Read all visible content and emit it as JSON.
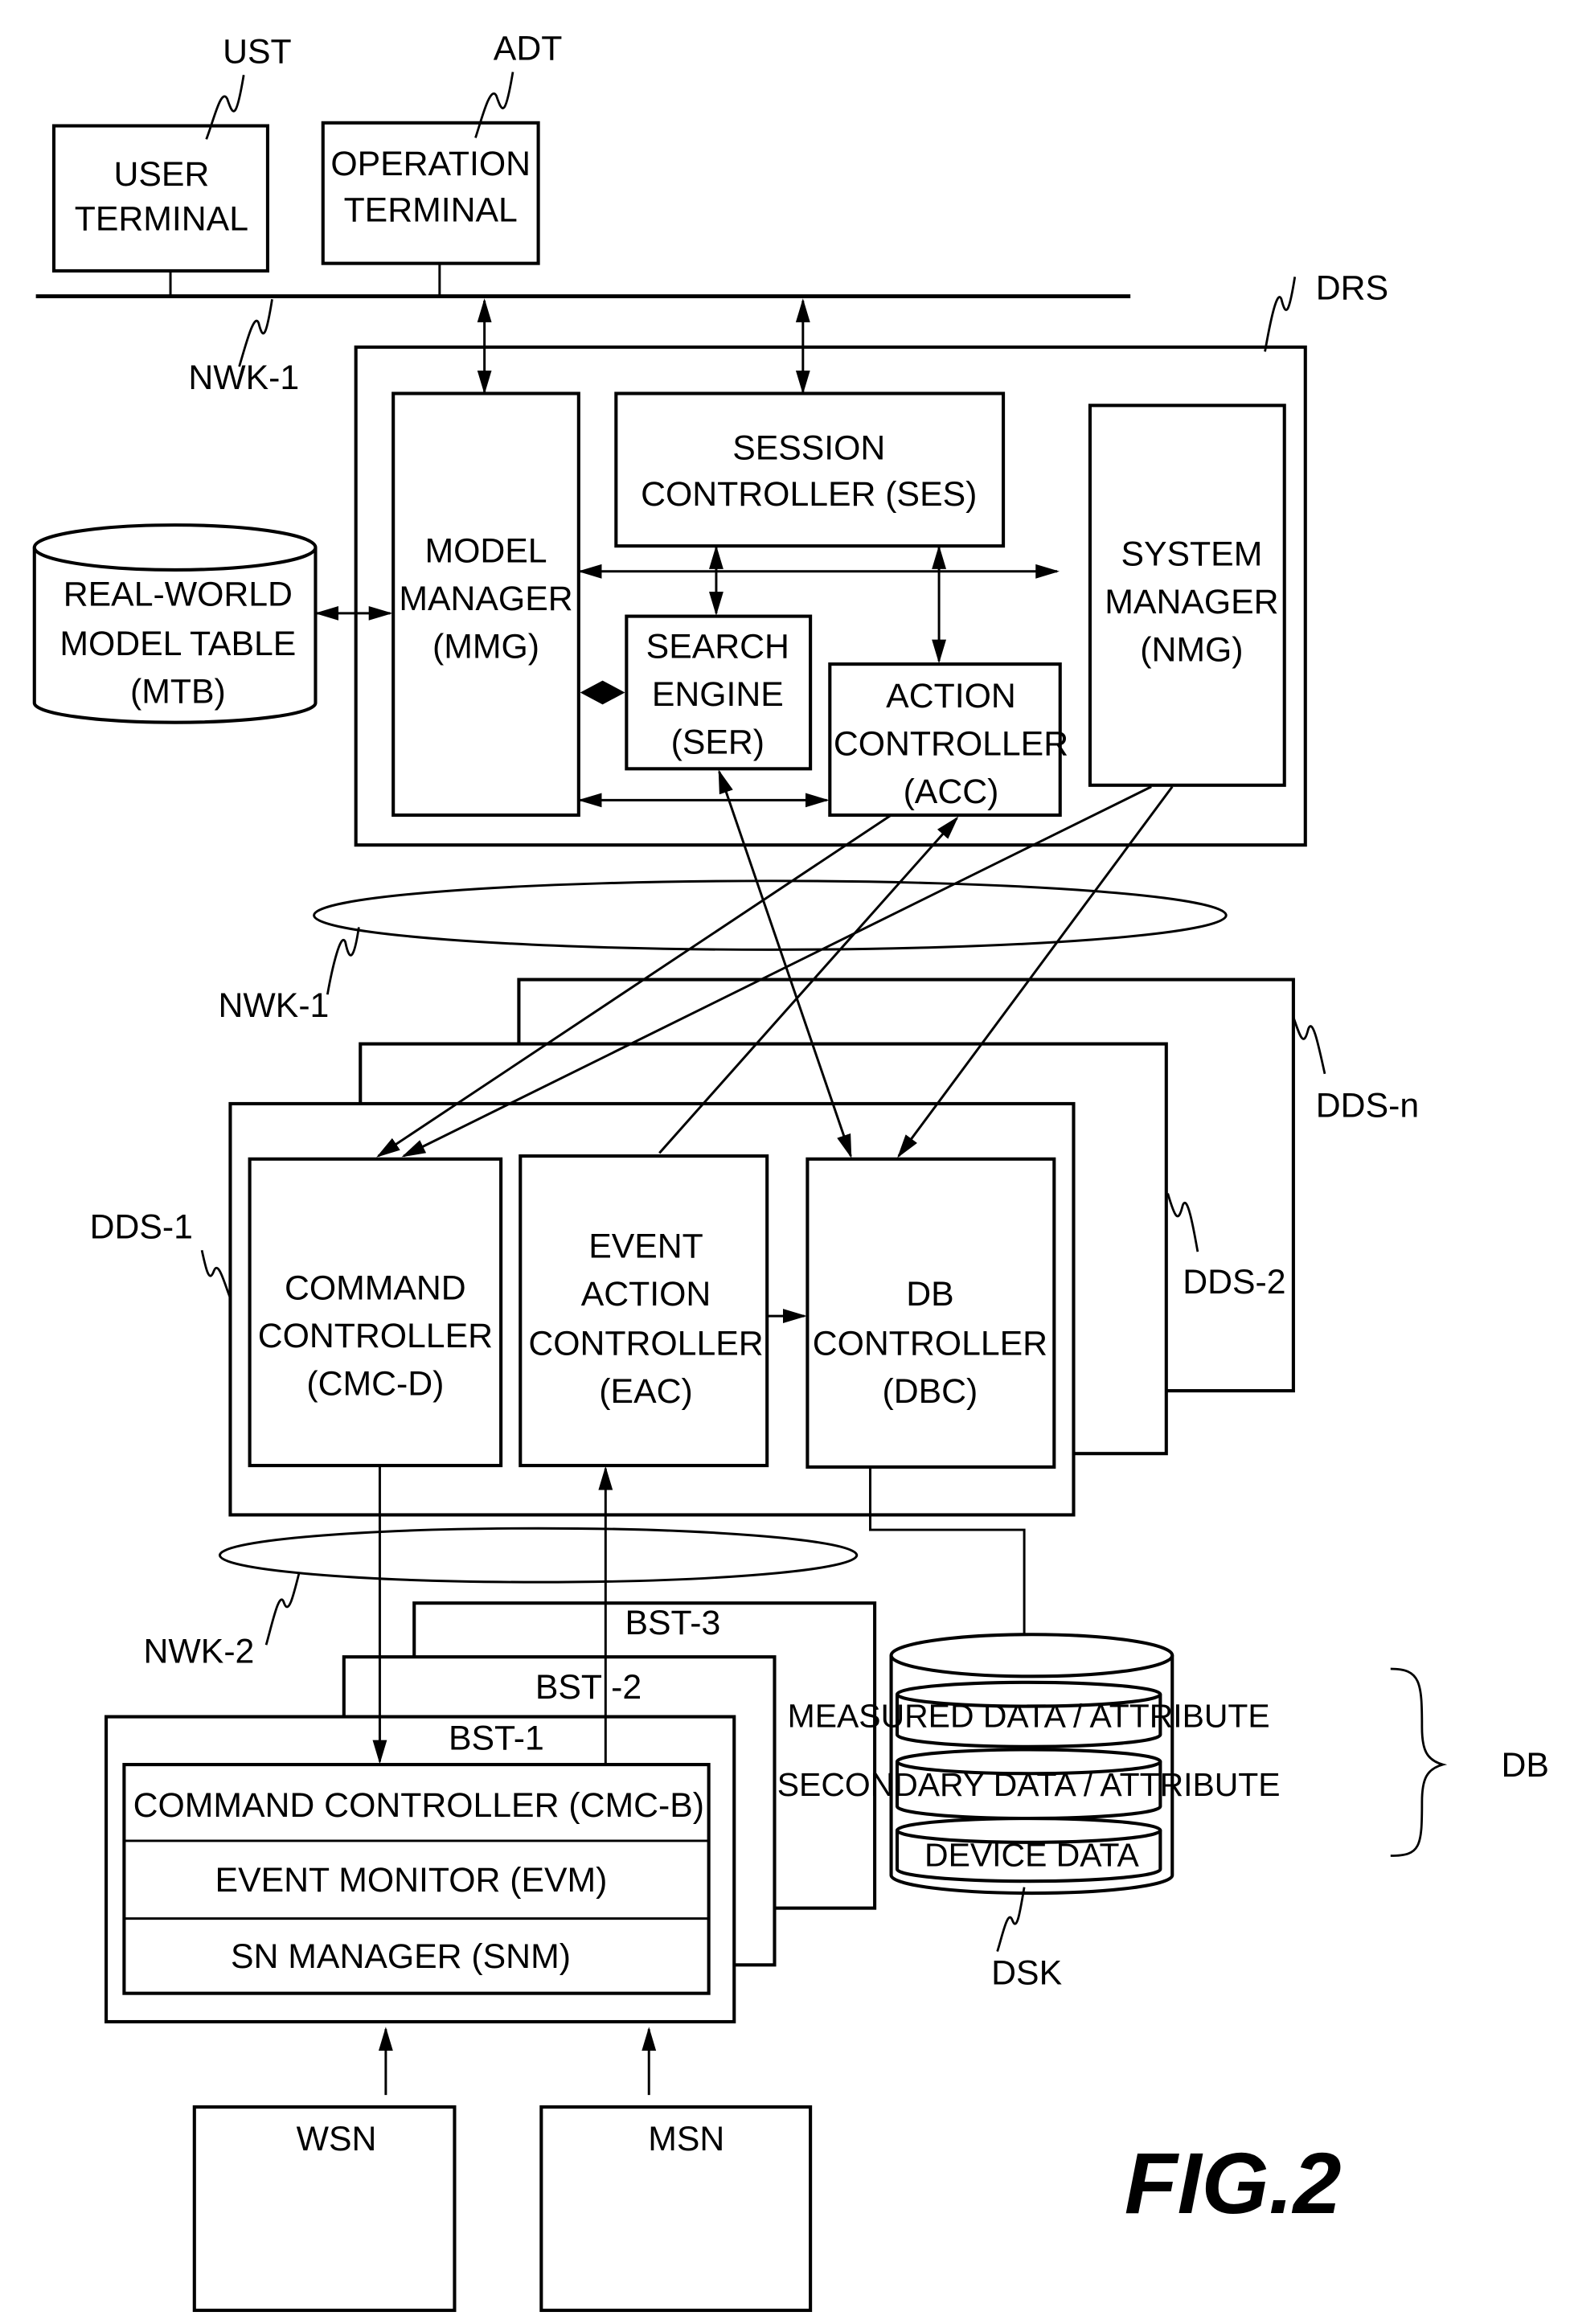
{
  "figure": {
    "title": "FIG.2",
    "type": "system block diagram"
  },
  "terminals": {
    "user_terminal": {
      "ref": "UST",
      "lines": [
        "USER",
        "TERMINAL"
      ]
    },
    "operation_terminal": {
      "ref": "ADT",
      "lines": [
        "OPERATION",
        "TERMINAL"
      ]
    }
  },
  "networks": {
    "top_bus": "NWK-1",
    "middle_network": "NWK-1",
    "lower_network": "NWK-2"
  },
  "drs": {
    "ref": "DRS",
    "model_manager": {
      "lines": [
        "MODEL",
        "MANAGER",
        "(MMG)"
      ]
    },
    "session_controller": {
      "lines": [
        "SESSION",
        "CONTROLLER (SES)"
      ]
    },
    "search_engine": {
      "lines": [
        "SEARCH",
        "ENGINE",
        "(SER)"
      ]
    },
    "action_controller": {
      "lines": [
        "ACTION",
        "CONTROLLER",
        "(ACC)"
      ]
    },
    "system_manager": {
      "lines": [
        "SYSTEM",
        "MANAGER",
        "(NMG)"
      ]
    }
  },
  "model_table": {
    "lines": [
      "REAL-WORLD",
      "MODEL TABLE",
      "(MTB)"
    ]
  },
  "dds": {
    "refs": [
      "DDS-1",
      "DDS-2",
      "DDS-n"
    ],
    "command_controller": {
      "lines": [
        "COMMAND",
        "CONTROLLER",
        "(CMC-D)"
      ]
    },
    "event_action_controller": {
      "lines": [
        "EVENT",
        "ACTION",
        "CONTROLLER",
        "(EAC)"
      ]
    },
    "db_controller": {
      "lines": [
        "DB",
        "CONTROLLER",
        "(DBC)"
      ]
    }
  },
  "disk": {
    "ref": "DSK",
    "db_ref": "DB",
    "layers": [
      "MEASURED DATA / ATTRIBUTE",
      "SECONDARY DATA / ATTRIBUTE",
      "DEVICE DATA"
    ]
  },
  "base_stations": {
    "refs": [
      "BST-1",
      "BST -2",
      "BST-3"
    ],
    "modules": [
      "COMMAND CONTROLLER (CMC-B)",
      "EVENT MONITOR (EVM)",
      "SN MANAGER (SNM)"
    ]
  },
  "sensor_nodes": [
    "WSN",
    "MSN"
  ]
}
